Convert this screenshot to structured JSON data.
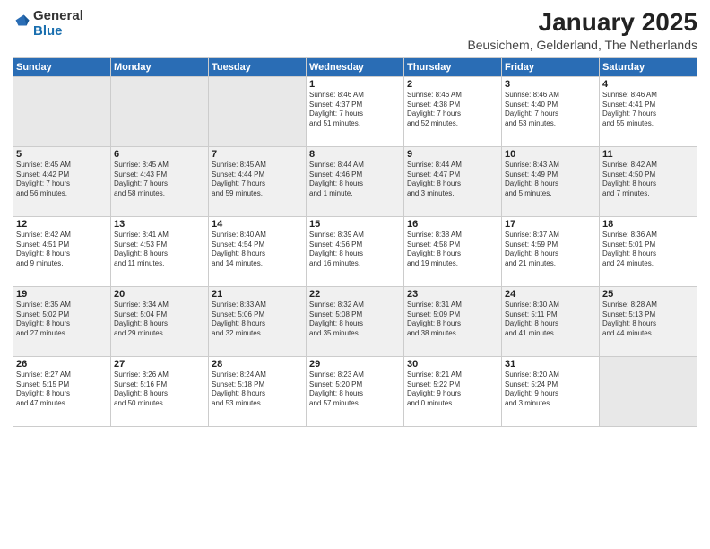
{
  "logo": {
    "general": "General",
    "blue": "Blue"
  },
  "header": {
    "month": "January 2025",
    "location": "Beusichem, Gelderland, The Netherlands"
  },
  "weekdays": [
    "Sunday",
    "Monday",
    "Tuesday",
    "Wednesday",
    "Thursday",
    "Friday",
    "Saturday"
  ],
  "weeks": [
    [
      {
        "day": "",
        "info": ""
      },
      {
        "day": "",
        "info": ""
      },
      {
        "day": "",
        "info": ""
      },
      {
        "day": "1",
        "info": "Sunrise: 8:46 AM\nSunset: 4:37 PM\nDaylight: 7 hours\nand 51 minutes."
      },
      {
        "day": "2",
        "info": "Sunrise: 8:46 AM\nSunset: 4:38 PM\nDaylight: 7 hours\nand 52 minutes."
      },
      {
        "day": "3",
        "info": "Sunrise: 8:46 AM\nSunset: 4:40 PM\nDaylight: 7 hours\nand 53 minutes."
      },
      {
        "day": "4",
        "info": "Sunrise: 8:46 AM\nSunset: 4:41 PM\nDaylight: 7 hours\nand 55 minutes."
      }
    ],
    [
      {
        "day": "5",
        "info": "Sunrise: 8:45 AM\nSunset: 4:42 PM\nDaylight: 7 hours\nand 56 minutes."
      },
      {
        "day": "6",
        "info": "Sunrise: 8:45 AM\nSunset: 4:43 PM\nDaylight: 7 hours\nand 58 minutes."
      },
      {
        "day": "7",
        "info": "Sunrise: 8:45 AM\nSunset: 4:44 PM\nDaylight: 7 hours\nand 59 minutes."
      },
      {
        "day": "8",
        "info": "Sunrise: 8:44 AM\nSunset: 4:46 PM\nDaylight: 8 hours\nand 1 minute."
      },
      {
        "day": "9",
        "info": "Sunrise: 8:44 AM\nSunset: 4:47 PM\nDaylight: 8 hours\nand 3 minutes."
      },
      {
        "day": "10",
        "info": "Sunrise: 8:43 AM\nSunset: 4:49 PM\nDaylight: 8 hours\nand 5 minutes."
      },
      {
        "day": "11",
        "info": "Sunrise: 8:42 AM\nSunset: 4:50 PM\nDaylight: 8 hours\nand 7 minutes."
      }
    ],
    [
      {
        "day": "12",
        "info": "Sunrise: 8:42 AM\nSunset: 4:51 PM\nDaylight: 8 hours\nand 9 minutes."
      },
      {
        "day": "13",
        "info": "Sunrise: 8:41 AM\nSunset: 4:53 PM\nDaylight: 8 hours\nand 11 minutes."
      },
      {
        "day": "14",
        "info": "Sunrise: 8:40 AM\nSunset: 4:54 PM\nDaylight: 8 hours\nand 14 minutes."
      },
      {
        "day": "15",
        "info": "Sunrise: 8:39 AM\nSunset: 4:56 PM\nDaylight: 8 hours\nand 16 minutes."
      },
      {
        "day": "16",
        "info": "Sunrise: 8:38 AM\nSunset: 4:58 PM\nDaylight: 8 hours\nand 19 minutes."
      },
      {
        "day": "17",
        "info": "Sunrise: 8:37 AM\nSunset: 4:59 PM\nDaylight: 8 hours\nand 21 minutes."
      },
      {
        "day": "18",
        "info": "Sunrise: 8:36 AM\nSunset: 5:01 PM\nDaylight: 8 hours\nand 24 minutes."
      }
    ],
    [
      {
        "day": "19",
        "info": "Sunrise: 8:35 AM\nSunset: 5:02 PM\nDaylight: 8 hours\nand 27 minutes."
      },
      {
        "day": "20",
        "info": "Sunrise: 8:34 AM\nSunset: 5:04 PM\nDaylight: 8 hours\nand 29 minutes."
      },
      {
        "day": "21",
        "info": "Sunrise: 8:33 AM\nSunset: 5:06 PM\nDaylight: 8 hours\nand 32 minutes."
      },
      {
        "day": "22",
        "info": "Sunrise: 8:32 AM\nSunset: 5:08 PM\nDaylight: 8 hours\nand 35 minutes."
      },
      {
        "day": "23",
        "info": "Sunrise: 8:31 AM\nSunset: 5:09 PM\nDaylight: 8 hours\nand 38 minutes."
      },
      {
        "day": "24",
        "info": "Sunrise: 8:30 AM\nSunset: 5:11 PM\nDaylight: 8 hours\nand 41 minutes."
      },
      {
        "day": "25",
        "info": "Sunrise: 8:28 AM\nSunset: 5:13 PM\nDaylight: 8 hours\nand 44 minutes."
      }
    ],
    [
      {
        "day": "26",
        "info": "Sunrise: 8:27 AM\nSunset: 5:15 PM\nDaylight: 8 hours\nand 47 minutes."
      },
      {
        "day": "27",
        "info": "Sunrise: 8:26 AM\nSunset: 5:16 PM\nDaylight: 8 hours\nand 50 minutes."
      },
      {
        "day": "28",
        "info": "Sunrise: 8:24 AM\nSunset: 5:18 PM\nDaylight: 8 hours\nand 53 minutes."
      },
      {
        "day": "29",
        "info": "Sunrise: 8:23 AM\nSunset: 5:20 PM\nDaylight: 8 hours\nand 57 minutes."
      },
      {
        "day": "30",
        "info": "Sunrise: 8:21 AM\nSunset: 5:22 PM\nDaylight: 9 hours\nand 0 minutes."
      },
      {
        "day": "31",
        "info": "Sunrise: 8:20 AM\nSunset: 5:24 PM\nDaylight: 9 hours\nand 3 minutes."
      },
      {
        "day": "",
        "info": ""
      }
    ]
  ]
}
